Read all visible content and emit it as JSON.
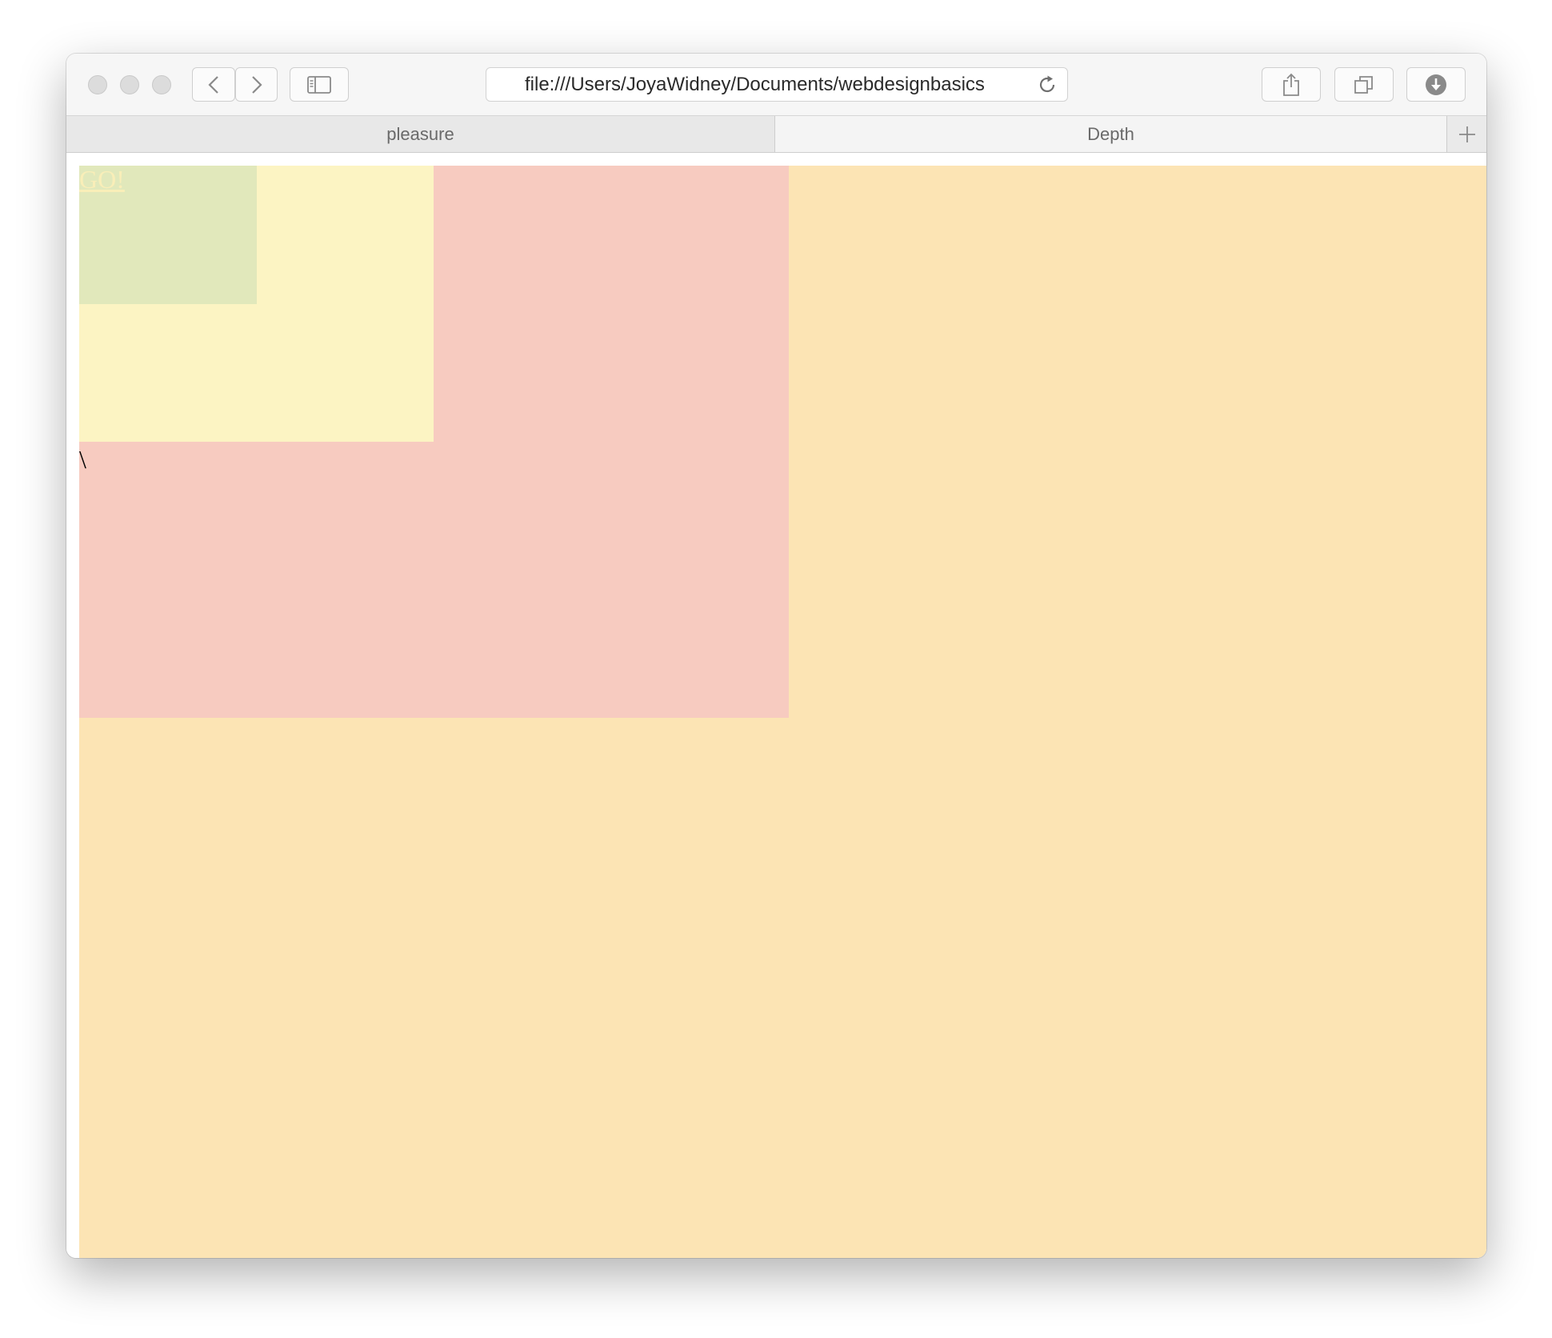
{
  "browser": {
    "url": "file:///Users/JoyaWidney/Documents/webdesignbasics",
    "tabs": [
      {
        "label": "pleasure",
        "active": false
      },
      {
        "label": "Depth",
        "active": true
      }
    ]
  },
  "page": {
    "link_text": "GO!",
    "stray_text": "\\",
    "colors": {
      "outer": "#fce4b4",
      "red": "#f7cbc0",
      "yellow": "#fcf4c3",
      "green": "#e1e8bb",
      "link": "#f9eeb8"
    }
  }
}
